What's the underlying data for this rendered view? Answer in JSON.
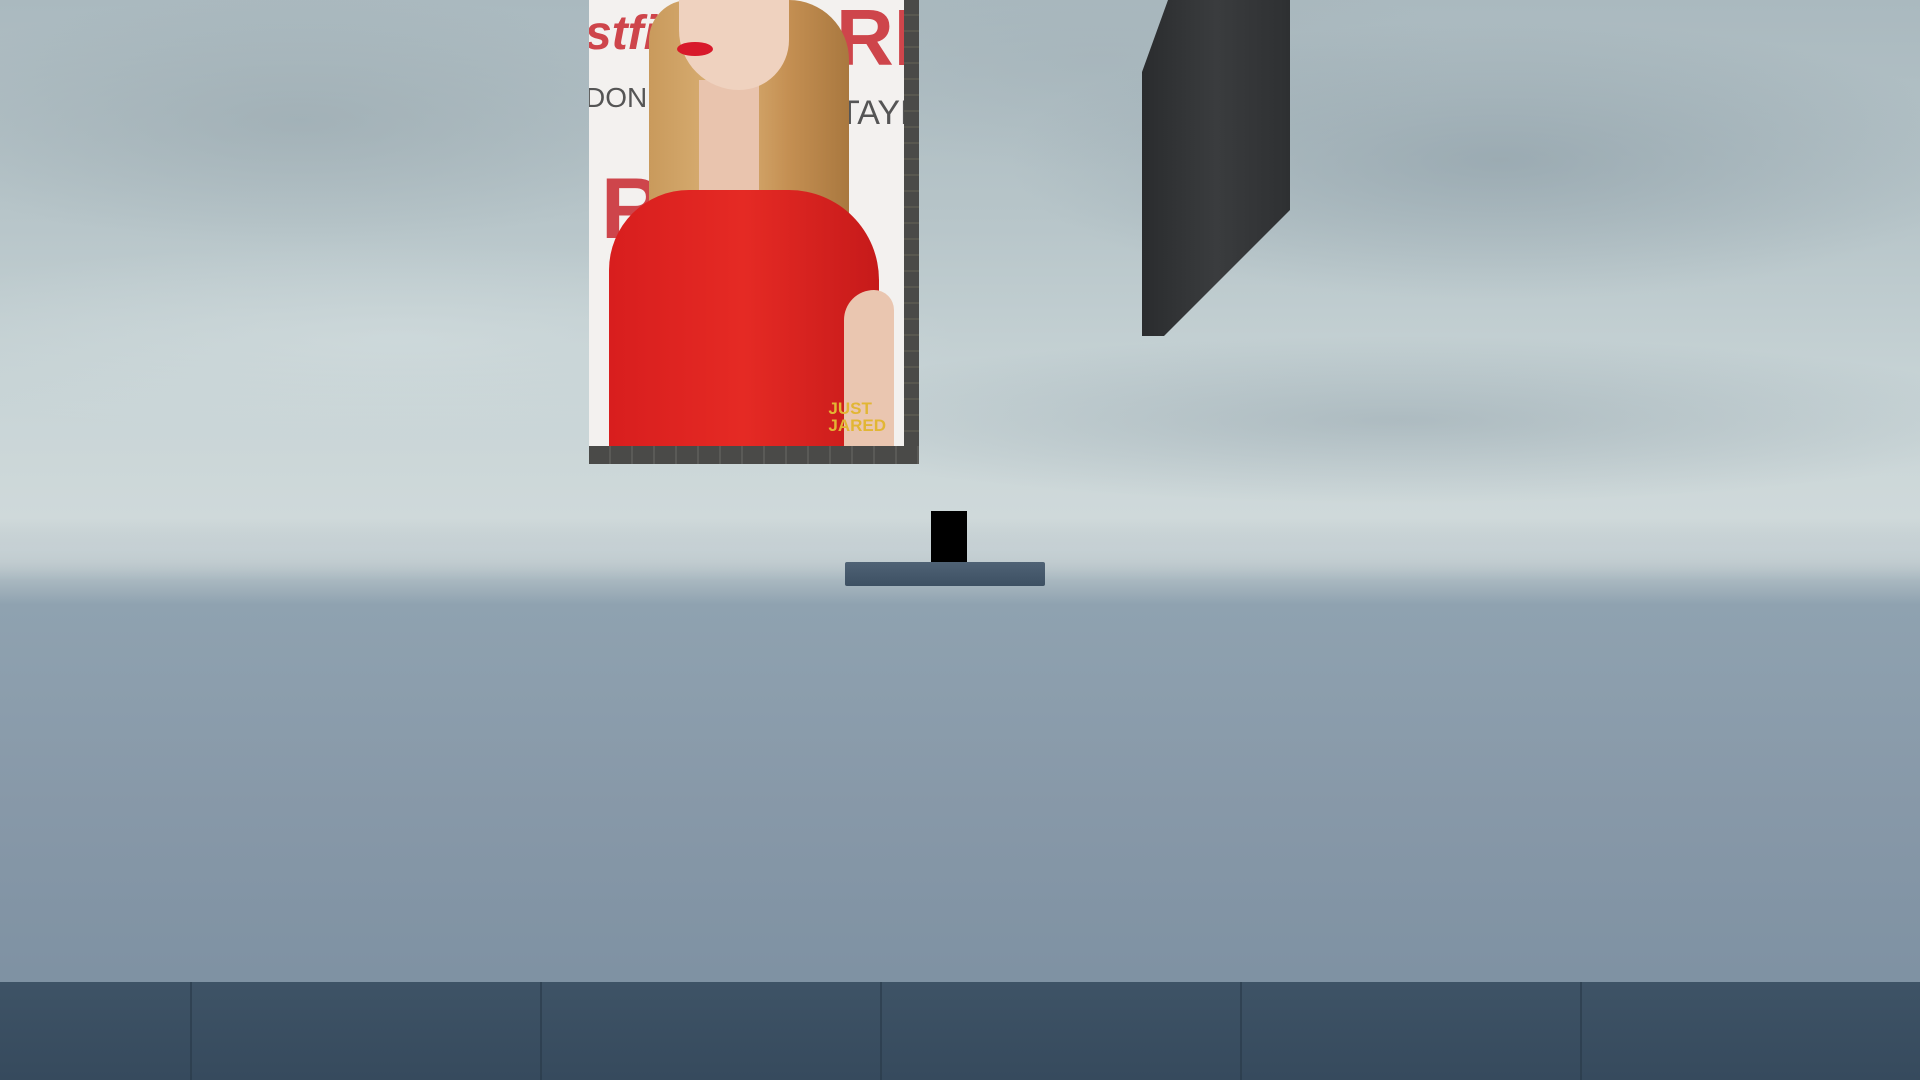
{
  "scene": {
    "colors": {
      "sky": "#c9d5d7",
      "ground": "#8798a8",
      "floor": "#3e5366",
      "panel": "#2c2e30",
      "block": "#000000",
      "platform": "#475a6d"
    }
  },
  "poster": {
    "text_top_left": "stfi",
    "text_line_2": "DON W",
    "text_top_right": "RE",
    "text_right_2": "TAYL",
    "text_mid_left": "R",
    "watermark_line_1": "JUST",
    "watermark_line_2": "JARED"
  }
}
